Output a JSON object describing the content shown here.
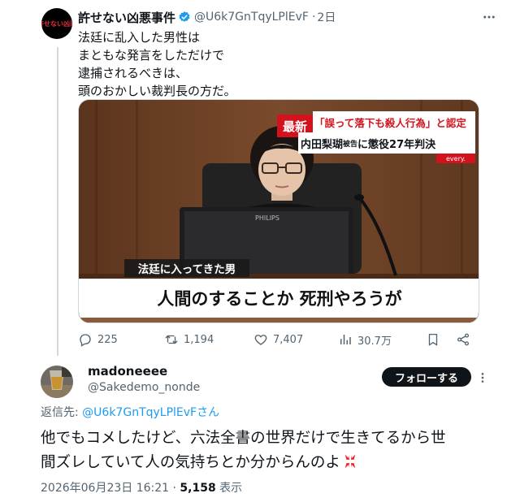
{
  "tweet": {
    "author_name": "許せない凶悪事件",
    "avatar_text": "許せない凶悪",
    "handle": "@U6k7GnTqyLPlEvF",
    "separator": "·",
    "time": "2日",
    "body_lines": [
      "法廷に乱入した男性は",
      "まともな発言をしただけで",
      "逮捕されるべきは、",
      "頭のおかしい裁判長の方だ。"
    ],
    "media": {
      "badge": "最新",
      "headline_1": "「誤って落下も殺人行為」と認定",
      "headline_2_name": "内田梨瑚",
      "headline_2_small": "被告",
      "headline_2_rest": "に懲役27年判決",
      "source_tag": "every.",
      "monitor_brand": "PHILIPS",
      "caption_small": "法廷に入ってきた男",
      "caption_large": "人間のすることか 死刑やろうが"
    },
    "actions": {
      "replies": "225",
      "retweets": "1,194",
      "likes": "7,407",
      "views": "30.7万"
    }
  },
  "reply": {
    "author_name": "madoneeee",
    "handle": "@Sakedemo_nonde",
    "follow_label": "フォローする",
    "reply_to_label": "返信先: ",
    "reply_to_handle": "@U6k7GnTqyLPlEvFさん",
    "body_lines": [
      "他でもコメしたけど、六法全書の世界だけで生きてるから世",
      "間ズレしていて人の気持ちとか分からんのよ"
    ],
    "emoji": "anger-emoji",
    "timestamp": "2026年06月23日 16:21",
    "separator": " · ",
    "views_count": "5,158",
    "views_label": " 表示"
  },
  "colors": {
    "accent": "#1d9bf0",
    "text": "#0f1419",
    "secondary": "#536471",
    "badge_red": "#d3121d",
    "anger_red": "#f4212e"
  },
  "icons": [
    "verified-badge-icon",
    "more-options-icon",
    "reply-icon",
    "retweet-icon",
    "like-icon",
    "views-icon",
    "bookmark-icon",
    "share-icon"
  ]
}
